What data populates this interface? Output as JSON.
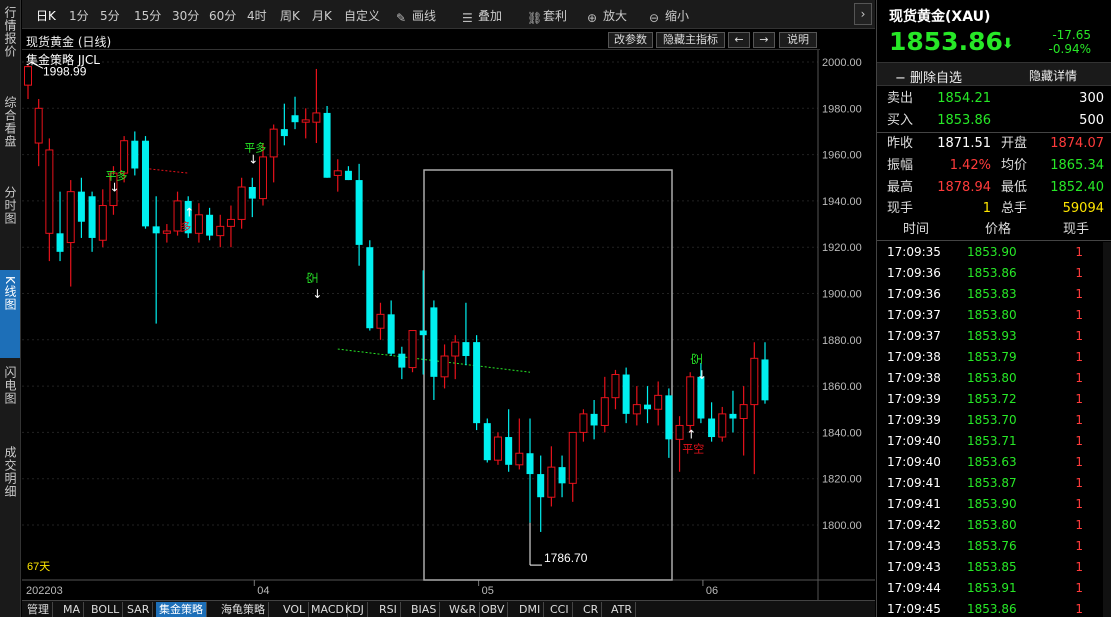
{
  "left_tabs": [
    {
      "label": "行情报价",
      "active": false
    },
    {
      "label": "综合看盘",
      "active": false
    },
    {
      "label": "分时图",
      "active": false
    },
    {
      "label": "K线图",
      "active": true
    },
    {
      "label": "闪电图",
      "active": false
    },
    {
      "label": "成交明细",
      "active": false
    }
  ],
  "toolbar": {
    "periods": [
      "日K",
      "1分",
      "5分",
      "15分",
      "30分",
      "60分",
      "4时",
      "周K",
      "月K",
      "自定义"
    ],
    "selected_period": "日K",
    "tools": [
      {
        "label": "画线",
        "icon": "pencil-icon"
      },
      {
        "label": "叠加",
        "icon": "layers-icon"
      },
      {
        "label": "套利",
        "icon": "link-icon"
      },
      {
        "label": "放大",
        "icon": "zoom-in-icon"
      },
      {
        "label": "缩小",
        "icon": "zoom-out-icon"
      }
    ],
    "nav_right": "›"
  },
  "chart_header": {
    "title": "现货黄金 (日线)",
    "buttons": [
      "改参数",
      "隐藏主指标",
      "←",
      "→",
      "说明"
    ],
    "indicator_label": "集金策略 JJCL"
  },
  "chart_data": {
    "type": "candlestick",
    "y_ticks": [
      "2000.00",
      "1980.00",
      "1960.00",
      "1940.00",
      "1920.00",
      "1900.00",
      "1880.00",
      "1860.00",
      "1840.00",
      "1820.00",
      "1800.00"
    ],
    "ylim": [
      1780,
      2005
    ],
    "x_labels": [
      {
        "label": "202203",
        "index": 0
      },
      {
        "label": "04",
        "index": 21
      },
      {
        "label": "05",
        "index": 42
      },
      {
        "label": "06",
        "index": 63
      }
    ],
    "days_label": "67天",
    "high_label": "1998.99",
    "low_label": "1786.70",
    "candles": [
      [
        1990,
        1998.99,
        1984,
        1998
      ],
      [
        1965,
        1984,
        1955,
        1980
      ],
      [
        1926,
        1967,
        1914,
        1962
      ],
      [
        1926,
        1944,
        1914,
        1918
      ],
      [
        1922,
        1949,
        1903,
        1944
      ],
      [
        1944,
        1950,
        1924,
        1931
      ],
      [
        1942,
        1944,
        1918,
        1924
      ],
      [
        1923,
        1945,
        1920,
        1938
      ],
      [
        1938,
        1955,
        1934,
        1952
      ],
      [
        1952,
        1968,
        1948,
        1966
      ],
      [
        1966,
        1970,
        1951,
        1954
      ],
      [
        1966,
        1968,
        1928,
        1929
      ],
      [
        1929,
        1942,
        1887,
        1926
      ],
      [
        1926,
        1930,
        1922,
        1927
      ],
      [
        1927,
        1944,
        1925,
        1940
      ],
      [
        1940,
        1942,
        1924,
        1926
      ],
      [
        1926,
        1939,
        1922,
        1934
      ],
      [
        1934,
        1937,
        1923,
        1925
      ],
      [
        1925,
        1934,
        1920,
        1929
      ],
      [
        1929,
        1938,
        1920,
        1932
      ],
      [
        1932,
        1950,
        1928,
        1946
      ],
      [
        1946,
        1950,
        1933,
        1941
      ],
      [
        1941,
        1965,
        1938,
        1959
      ],
      [
        1959,
        1973,
        1948,
        1971
      ],
      [
        1971,
        1982,
        1964,
        1968
      ],
      [
        1977,
        1985,
        1971,
        1974
      ],
      [
        1974,
        1980,
        1967,
        1975
      ],
      [
        1974,
        1997,
        1965,
        1978
      ],
      [
        1978,
        1981,
        1950,
        1950
      ],
      [
        1951,
        1958,
        1944,
        1953
      ],
      [
        1953,
        1955,
        1949,
        1949
      ],
      [
        1949,
        1956,
        1912,
        1921
      ],
      [
        1920,
        1923,
        1884,
        1885
      ],
      [
        1885,
        1896,
        1880,
        1891
      ],
      [
        1891,
        1897,
        1873,
        1874
      ],
      [
        1874,
        1877,
        1863,
        1868
      ],
      [
        1868,
        1882,
        1866,
        1884
      ],
      [
        1884,
        1910,
        1865,
        1882
      ],
      [
        1894,
        1897,
        1854,
        1864
      ],
      [
        1864,
        1878,
        1859,
        1873
      ],
      [
        1873,
        1882,
        1863,
        1879
      ],
      [
        1879,
        1896,
        1869,
        1873
      ],
      [
        1879,
        1882,
        1841,
        1844
      ],
      [
        1844,
        1846,
        1827,
        1828
      ],
      [
        1828,
        1840,
        1826,
        1838
      ],
      [
        1838,
        1850,
        1823,
        1826
      ],
      [
        1826,
        1846,
        1824,
        1831
      ],
      [
        1831,
        1846,
        1801,
        1822
      ],
      [
        1822,
        1830,
        1797,
        1812
      ],
      [
        1812,
        1834,
        1808,
        1825
      ],
      [
        1825,
        1830,
        1812,
        1818
      ],
      [
        1818,
        1840,
        1810,
        1840
      ],
      [
        1840,
        1850,
        1836,
        1848
      ],
      [
        1848,
        1854,
        1837,
        1843
      ],
      [
        1843,
        1864,
        1840,
        1855
      ],
      [
        1855,
        1867,
        1850,
        1865
      ],
      [
        1865,
        1868,
        1844,
        1848
      ],
      [
        1848,
        1860,
        1843,
        1852
      ],
      [
        1852,
        1860,
        1844,
        1850
      ],
      [
        1850,
        1862,
        1843,
        1856
      ],
      [
        1856,
        1859,
        1829,
        1837
      ],
      [
        1837,
        1847,
        1823,
        1843
      ],
      [
        1843,
        1866,
        1840,
        1864
      ],
      [
        1864,
        1870,
        1844,
        1846
      ],
      [
        1846,
        1853,
        1836,
        1838
      ],
      [
        1838,
        1851,
        1836,
        1848
      ],
      [
        1848,
        1858,
        1840,
        1846
      ],
      [
        1846,
        1860,
        1830,
        1852
      ],
      [
        1852,
        1878.94,
        1822,
        1872
      ],
      [
        1871.51,
        1878.94,
        1852.4,
        1853.86
      ]
    ],
    "signals": [
      {
        "label": "平多",
        "index": 7,
        "position": "above"
      },
      {
        "label": "多",
        "index": 13,
        "position": "below"
      },
      {
        "label": "平多",
        "index": 19,
        "position": "above"
      },
      {
        "label": "空",
        "index": 28,
        "position": "above"
      },
      {
        "label": "平空",
        "index": 46,
        "position": "below"
      },
      {
        "label": "空",
        "index": 48,
        "position": "above"
      }
    ]
  },
  "indicator_tabs": [
    "管理",
    "MA",
    "BOLL",
    "SAR",
    "集金策略",
    "海龟策略",
    "VOL",
    "MACD",
    "KDJ",
    "RSI",
    "BIAS",
    "W&R",
    "OBV",
    "DMI",
    "CCI",
    "CR",
    "ATR"
  ],
  "active_indicator": "集金策略",
  "quote": {
    "name": "现货黄金(XAU)",
    "price": "1853.86",
    "change": "-17.65",
    "change_pct": "-0.94%",
    "delete_watch": "删除自选",
    "hide_detail": "隐藏详情",
    "sell_label": "卖出",
    "sell_price": "1854.21",
    "sell_vol": "300",
    "buy_label": "买入",
    "buy_price": "1853.86",
    "buy_vol": "500",
    "prev_close_label": "昨收",
    "prev_close": "1871.51",
    "open_label": "开盘",
    "open": "1874.07",
    "amplitude_label": "振幅",
    "amplitude": "1.42%",
    "avg_label": "均价",
    "avg": "1865.34",
    "high_label": "最高",
    "high": "1878.94",
    "low_label": "最低",
    "low": "1852.40",
    "cur_vol_label": "现手",
    "cur_vol": "1",
    "total_vol_label": "总手",
    "total_vol": "59094"
  },
  "trades": {
    "headers": [
      "时间",
      "价格",
      "现手"
    ],
    "rows": [
      {
        "time": "17:09:35",
        "price": "1853.90",
        "vol": "1"
      },
      {
        "time": "17:09:36",
        "price": "1853.86",
        "vol": "1"
      },
      {
        "time": "17:09:36",
        "price": "1853.83",
        "vol": "1"
      },
      {
        "time": "17:09:37",
        "price": "1853.80",
        "vol": "1"
      },
      {
        "time": "17:09:37",
        "price": "1853.93",
        "vol": "1"
      },
      {
        "time": "17:09:38",
        "price": "1853.79",
        "vol": "1"
      },
      {
        "time": "17:09:38",
        "price": "1853.80",
        "vol": "1"
      },
      {
        "time": "17:09:39",
        "price": "1853.72",
        "vol": "1"
      },
      {
        "time": "17:09:39",
        "price": "1853.70",
        "vol": "1"
      },
      {
        "time": "17:09:40",
        "price": "1853.71",
        "vol": "1"
      },
      {
        "time": "17:09:40",
        "price": "1853.63",
        "vol": "1"
      },
      {
        "time": "17:09:41",
        "price": "1853.87",
        "vol": "1"
      },
      {
        "time": "17:09:41",
        "price": "1853.90",
        "vol": "1"
      },
      {
        "time": "17:09:42",
        "price": "1853.80",
        "vol": "1"
      },
      {
        "time": "17:09:43",
        "price": "1853.76",
        "vol": "1"
      },
      {
        "time": "17:09:43",
        "price": "1853.85",
        "vol": "1"
      },
      {
        "time": "17:09:44",
        "price": "1853.91",
        "vol": "1"
      },
      {
        "time": "17:09:45",
        "price": "1853.86",
        "vol": "1"
      }
    ]
  },
  "colors": {
    "up": "#e8121b",
    "down": "#00f0f0",
    "accent": "#1d6fb8",
    "green": "#27e827",
    "red": "#ff3b3b"
  }
}
